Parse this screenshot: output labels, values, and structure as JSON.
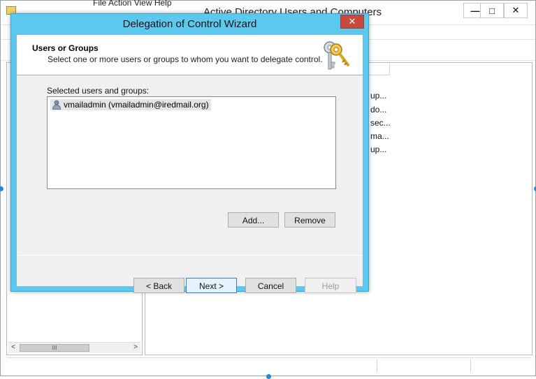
{
  "background_window": {
    "title": "Active Directory Users and Computers",
    "menu_partial": "File   Action   View   Help",
    "controls": {
      "minimize": "—",
      "maximize": "□",
      "close": "✕"
    },
    "right_pane_rows": [
      "up...",
      "do...",
      "sec...",
      "ma...",
      "up..."
    ],
    "scroll_left": "<",
    "scroll_thumb": "III",
    "scroll_right": ">"
  },
  "wizard": {
    "title": "Delegation of Control Wizard",
    "close_glyph": "✕",
    "heading": "Users or Groups",
    "subheading": "Select one or more users or groups to whom you want to delegate control.",
    "header_icon": "keys-icon",
    "list_label": "Selected users and groups:",
    "items": [
      {
        "label": "vmailadmin (vmailadmin@iredmail.org)",
        "icon": "user-icon"
      }
    ],
    "buttons": {
      "add": "Add...",
      "remove": "Remove",
      "back": "< Back",
      "next": "Next >",
      "cancel": "Cancel",
      "help": "Help"
    }
  },
  "colors": {
    "title_bar": "#5bc8ee",
    "close_button": "#c9483f",
    "selection_accent": "#1e88e5"
  }
}
